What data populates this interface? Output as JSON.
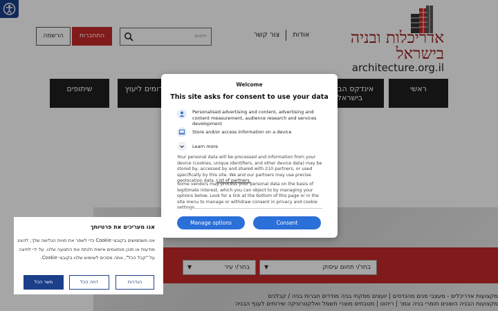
{
  "site": {
    "logo_he": "אדריכלות ובניה בישראל",
    "logo_en": "architecture.org.il",
    "brand_color": "#c62828"
  },
  "topnav": {
    "about": "אודות",
    "contact": "צור קשר"
  },
  "search": {
    "placeholder": "חיפוש",
    "icon": "search-icon"
  },
  "auth": {
    "login": "התחברות",
    "signup": "הרשמה"
  },
  "mainnav": [
    {
      "label": "ראשי"
    },
    {
      "label": "אינדקס הבנייה בישראל"
    },
    {
      "label": "פורומים ליעוץ"
    },
    {
      "label": "שיתופים"
    }
  ],
  "hero_search": {
    "field_select": "בחר/י תחום עיסוק",
    "city_select": "בחר/י עיר"
  },
  "categories": {
    "line1": "מקצועות  אדריכלים - מעצבי פנים  מהנדסים | יועצים  מפקחי בניה מודדים  חברות בניה / קבלנים",
    "line2": "מקצועות הבניה השונים  חומרי בניה וגמר | ריהוט | מטבחים  מוצרי חשמל ואלקטרוניקה  שירותים לענף הבניה"
  },
  "consent_modal": {
    "welcome": "Welcome",
    "title": "This site asks for consent to use your data",
    "purpose_1": "Personalised advertising and content, advertising and content measurement, audience research and services development",
    "purpose_2": "Store and/or access information on a device",
    "learn_more": "Learn more",
    "para_1": "Your personal data will be processed and information from your device (cookies, unique identifiers, and other device data) may be stored by, accessed by and shared with 210 partners, or used specifically by this site. We and our partners may use precise geolocation data.",
    "partners_link": "List of partners.",
    "para_2": "Some vendors may process your personal data on the basis of legitimate interest, which you can object to by managing your options below. Look for a link at the bottom of this page or in the site menu to manage or withdraw consent in privacy and cookie settings.",
    "manage_btn": "Manage options",
    "consent_btn": "Consent",
    "button_color": "#2b6fd8"
  },
  "cookie_banner": {
    "title": "אנו מעריכים את פרטיותך",
    "text": "אנו משתמשים בקובצי Cookie כדי לשפר את חווית הגלישה שלך, להציג מודעות או תוכן מותאמים אישית ולנתח את התנועה שלנו. על ידי לחיצה על \"קבל הכל\", אתה מסכים לשימוש שלנו בקובצי Cookie.",
    "settings": "הגדרות",
    "reject": "דחה הכל",
    "accept": "משר הכל",
    "button_color": "#1b3f8a"
  }
}
